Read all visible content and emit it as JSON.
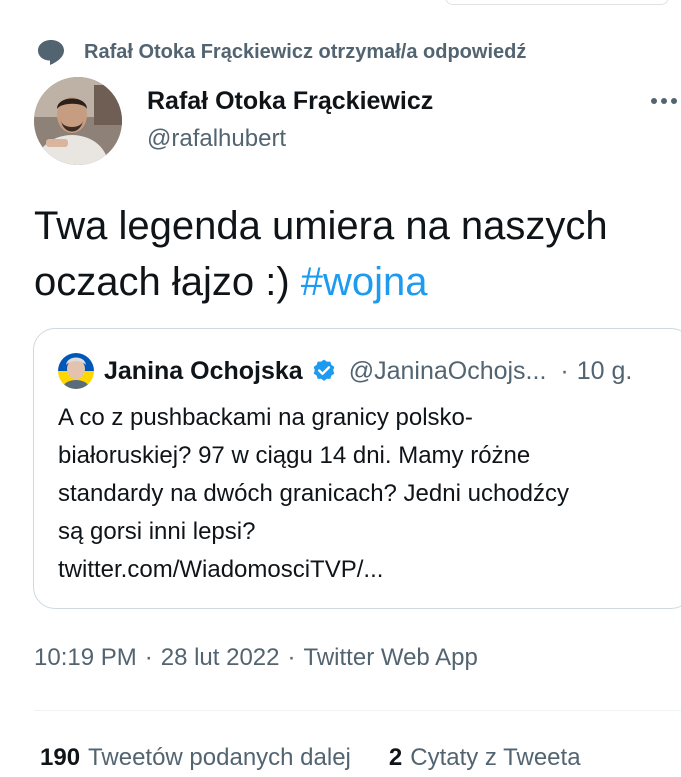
{
  "social_context": {
    "icon": "reply-bubble-icon",
    "text": "Rafał Otoka Frąckiewicz otrzymał/a odpowiedź"
  },
  "tweet": {
    "author_name": "Rafał Otoka Frąckiewicz",
    "author_handle": "@rafalhubert",
    "text_before_hashtag": "Twa legenda umiera na naszych oczach łajzo :) ",
    "hashtag": "#wojna"
  },
  "quote": {
    "author_name": "Janina Ochojska",
    "author_handle": "@JaninaOchojs...",
    "separator": "·",
    "time": "10 g.",
    "text": "A co z pushbackami na granicy polsko-\nbiałoruskiej? 97 w ciągu 14 dni. Mamy różne\nstandardy na dwóch granicach? Jedni uchodźcy\nsą gorsi inni lepsi?\ntwitter.com/WiadomosciTVP/..."
  },
  "meta": {
    "time": "10:19 PM",
    "separator": "·",
    "date": "28 lut 2022",
    "separator2": "·",
    "source": "Twitter Web App"
  },
  "stats": {
    "retweets_count": "190",
    "retweets_label": "Tweetów podanych dalej",
    "quotes_count": "2",
    "quotes_label": "Cytaty z Tweeta"
  },
  "colors": {
    "accent": "#1d9bf0",
    "secondary_text": "#536471",
    "primary_text": "#0f1419",
    "border": "#cfd9de"
  }
}
